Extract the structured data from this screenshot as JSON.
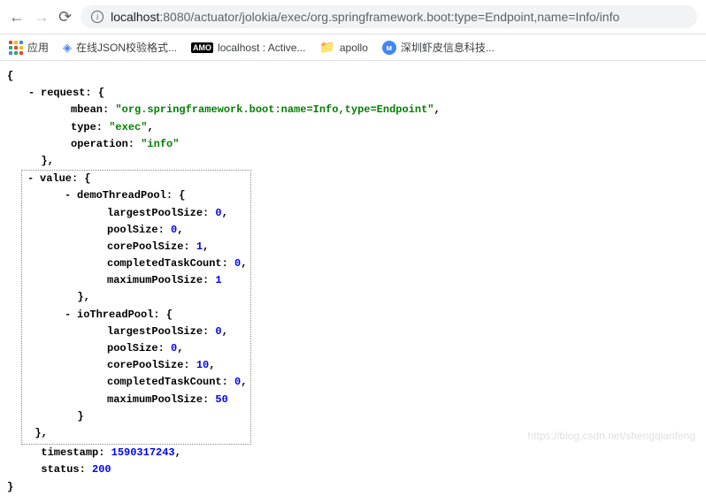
{
  "url": {
    "host": "localhost",
    "port": ":8080",
    "path": "/actuator/jolokia/exec/org.springframework.boot:type=Endpoint,name=Info/info"
  },
  "bookmarks": {
    "apps": "应用",
    "json": "在线JSON校验格式...",
    "local": "localhost : Active...",
    "apollo": "apollo",
    "shenzhen": "深圳虾皮信息科技..."
  },
  "json": {
    "request": {
      "mbean": "\"org.springframework.boot:name=Info,type=Endpoint\"",
      "type": "\"exec\"",
      "operation": "\"info\""
    },
    "value": {
      "demoThreadPool": {
        "largestPoolSize": "0",
        "poolSize": "0",
        "corePoolSize": "1",
        "completedTaskCount": "0",
        "maximumPoolSize": "1"
      },
      "ioThreadPool": {
        "largestPoolSize": "0",
        "poolSize": "0",
        "corePoolSize": "10",
        "completedTaskCount": "0",
        "maximumPoolSize": "50"
      }
    },
    "timestamp": "1590317243",
    "status": "200"
  },
  "labels": {
    "request": "request:",
    "mbean": "mbean:",
    "type": "type:",
    "operation": "operation:",
    "value": "value:",
    "demoThreadPool": "demoThreadPool:",
    "ioThreadPool": "ioThreadPool:",
    "largestPoolSize": "largestPoolSize:",
    "poolSize": "poolSize:",
    "corePoolSize": "corePoolSize:",
    "completedTaskCount": "completedTaskCount:",
    "maximumPoolSize": "maximumPoolSize:",
    "timestamp": "timestamp:",
    "status": "status:"
  },
  "watermark": "https://blog.csdn.net/shengqianfeng"
}
